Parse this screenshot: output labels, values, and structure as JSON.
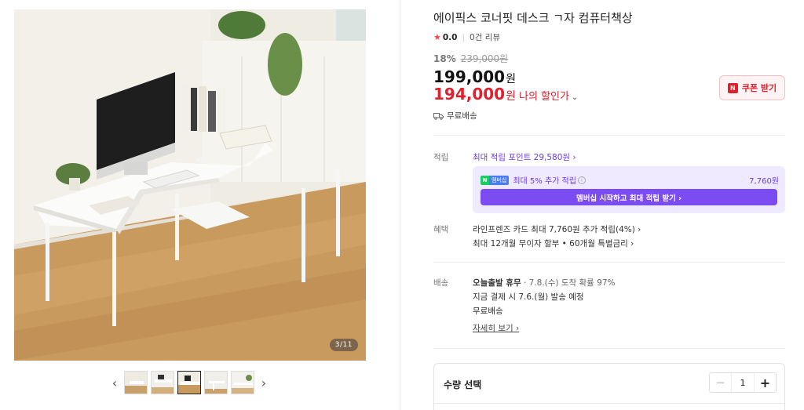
{
  "product": {
    "title": "에이픽스 코너핏 데스크 ㄱ자 컴퓨터책상",
    "rating": {
      "star_icon": "star-icon",
      "score": "0.0",
      "reviews": "0건 리뷰"
    },
    "discount_rate": "18%",
    "original_price": "239,000원",
    "price": "199,000",
    "price_unit": "원",
    "sale_price": "194,000",
    "sale_unit": "원",
    "sale_label": "나의 할인가",
    "coupon_label": "쿠폰 받기",
    "coupon_badge": "N",
    "shipping": "무료배송"
  },
  "gallery": {
    "page_indicator": "3/11",
    "thumbnail_count": 5,
    "active_thumbnail": 3,
    "prev_icon": "‹",
    "next_icon": "›"
  },
  "points": {
    "label": "적립",
    "max_points_text": "최대 적립 포인트 29,580원 ›",
    "membership": {
      "badge_n": "N",
      "badge_plus": "멤버십",
      "text": "최대 5% 추가 적립",
      "amount": "7,760원",
      "button_label": "멤버십 시작하고 최대 적립 받기 ›"
    }
  },
  "benefits": {
    "label": "혜택",
    "lines": [
      "라인프렌즈 카드 최대 7,760원 추가 적립(4%) ›",
      "최대 12개월 무이자 할부 • 60개월 특별금리 ›"
    ]
  },
  "delivery": {
    "label": "배송",
    "line1_bold": "오늘출발 휴무",
    "line1_rest": " · 7.8.(수) 도착 확률 97%",
    "line2": "지금 결제 시 7.6.(월) 발송 예정",
    "line3": "무료배송",
    "detail_link": "자세히 보기 ›"
  },
  "quantity": {
    "label": "수량 선택",
    "value": "1",
    "minus": "−",
    "plus": "+"
  },
  "colors": {
    "sale_red": "#e0202d",
    "membership_purple": "#7b4cf2",
    "membership_bg": "#efeaff"
  }
}
